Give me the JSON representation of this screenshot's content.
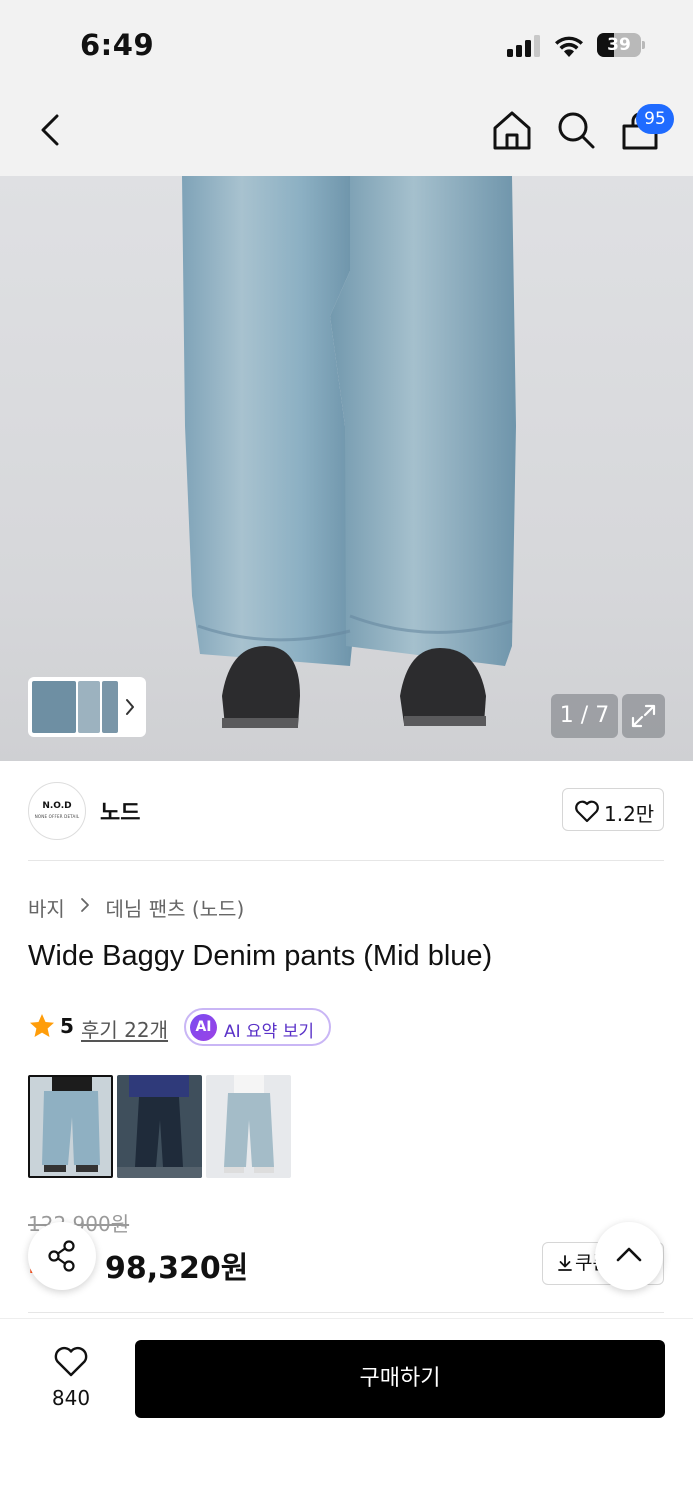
{
  "status_bar": {
    "time": "6:49",
    "battery": "39",
    "battery_level": 0.39
  },
  "header": {
    "back_icon": "chevron-left-icon",
    "home_icon": "home-icon",
    "search_icon": "search-icon",
    "cart_icon": "shopping-bag-icon",
    "cart_badge": "95"
  },
  "gallery": {
    "counter": "1 / 7",
    "expand_icon": "expand-icon",
    "thumb_next_icon": "chevron-right-icon"
  },
  "brand": {
    "logo_text": "N.O.D",
    "logo_subtext": "NONE OFFER DETAIL",
    "name": "노드",
    "likes": "1.2만"
  },
  "product": {
    "breadcrumb": [
      "바지",
      "데님 팬츠 (노드)"
    ],
    "title": "Wide Baggy Denim pants (Mid blue)",
    "rating": "5",
    "reviews": "후기 22개",
    "ai_badge": "AI",
    "ai_summary": "AI 요약 보기"
  },
  "price": {
    "original": "122,900원",
    "discount": "2",
    "sale": "98,320원",
    "coupon_label": "쿠폰"
  },
  "bottom_bar": {
    "wish_count": "840",
    "buy_label": "구매하기"
  },
  "colors": {
    "accent_blue": "#1f6bff",
    "discount_red": "#ff4f1a",
    "star_orange": "#ff9d0a",
    "ai_purple": "#7a4cf0",
    "denim": "#86a9bd"
  }
}
